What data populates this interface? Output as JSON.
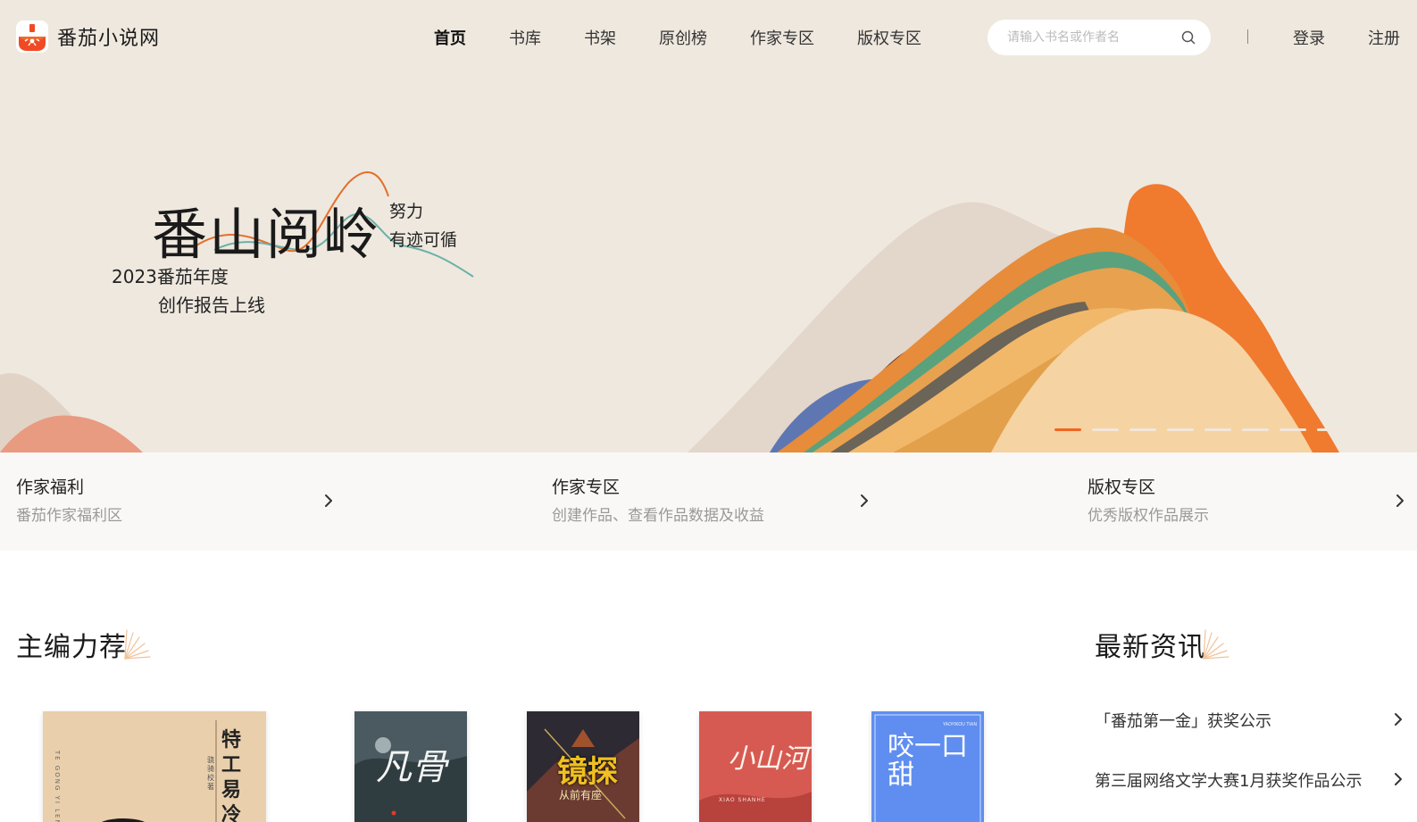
{
  "header": {
    "logo_text": "番茄小说网",
    "nav": [
      {
        "label": "首页",
        "active": true
      },
      {
        "label": "书库",
        "active": false
      },
      {
        "label": "书架",
        "active": false
      },
      {
        "label": "原创榜",
        "active": false
      },
      {
        "label": "作家专区",
        "active": false
      },
      {
        "label": "版权专区",
        "active": false
      }
    ],
    "search_placeholder": "请输入书名或作者名",
    "login_label": "登录",
    "register_label": "注册"
  },
  "banner": {
    "title": "番山阅岭",
    "slogan_line1": "努力",
    "slogan_line2": "有迹可循",
    "subtitle_line1": "2023番茄年度",
    "subtitle_line2": "创作报告上线",
    "slide_count": 8,
    "active_slide": 1
  },
  "quick_links": [
    {
      "title": "作家福利",
      "desc": "番茄作家福利区"
    },
    {
      "title": "作家专区",
      "desc": "创建作品、查看作品数据及收益"
    },
    {
      "title": "版权专区",
      "desc": "优秀版权作品展示"
    }
  ],
  "editor_picks": {
    "title": "主编力荐",
    "books": [
      {
        "cover_text": "特工易冷",
        "cover_pinyin": "TE GONG YI LENG",
        "cover_author": "骁骑校 著"
      },
      {
        "cover_text": "凡骨"
      },
      {
        "cover_text": "镜探",
        "cover_subtext": "从前有座"
      },
      {
        "cover_text": "小山河",
        "cover_pinyin": "XIAO SHANHE"
      },
      {
        "cover_text": "咬一口甜",
        "cover_pinyin": "YAOYIKOU TIAN"
      }
    ]
  },
  "news": {
    "title": "最新资讯",
    "items": [
      {
        "text": "「番茄第一金」获奖公示"
      },
      {
        "text": "第三届网络文学大赛1月获奖作品公示"
      }
    ]
  },
  "colors": {
    "accent": "#f26522",
    "hero_bg": "#efe8df",
    "quick_bg": "#faf8f6"
  },
  "icons": [
    "logo-tomato-icon",
    "search-icon",
    "chevron-right-icon",
    "sparkle-icon"
  ]
}
